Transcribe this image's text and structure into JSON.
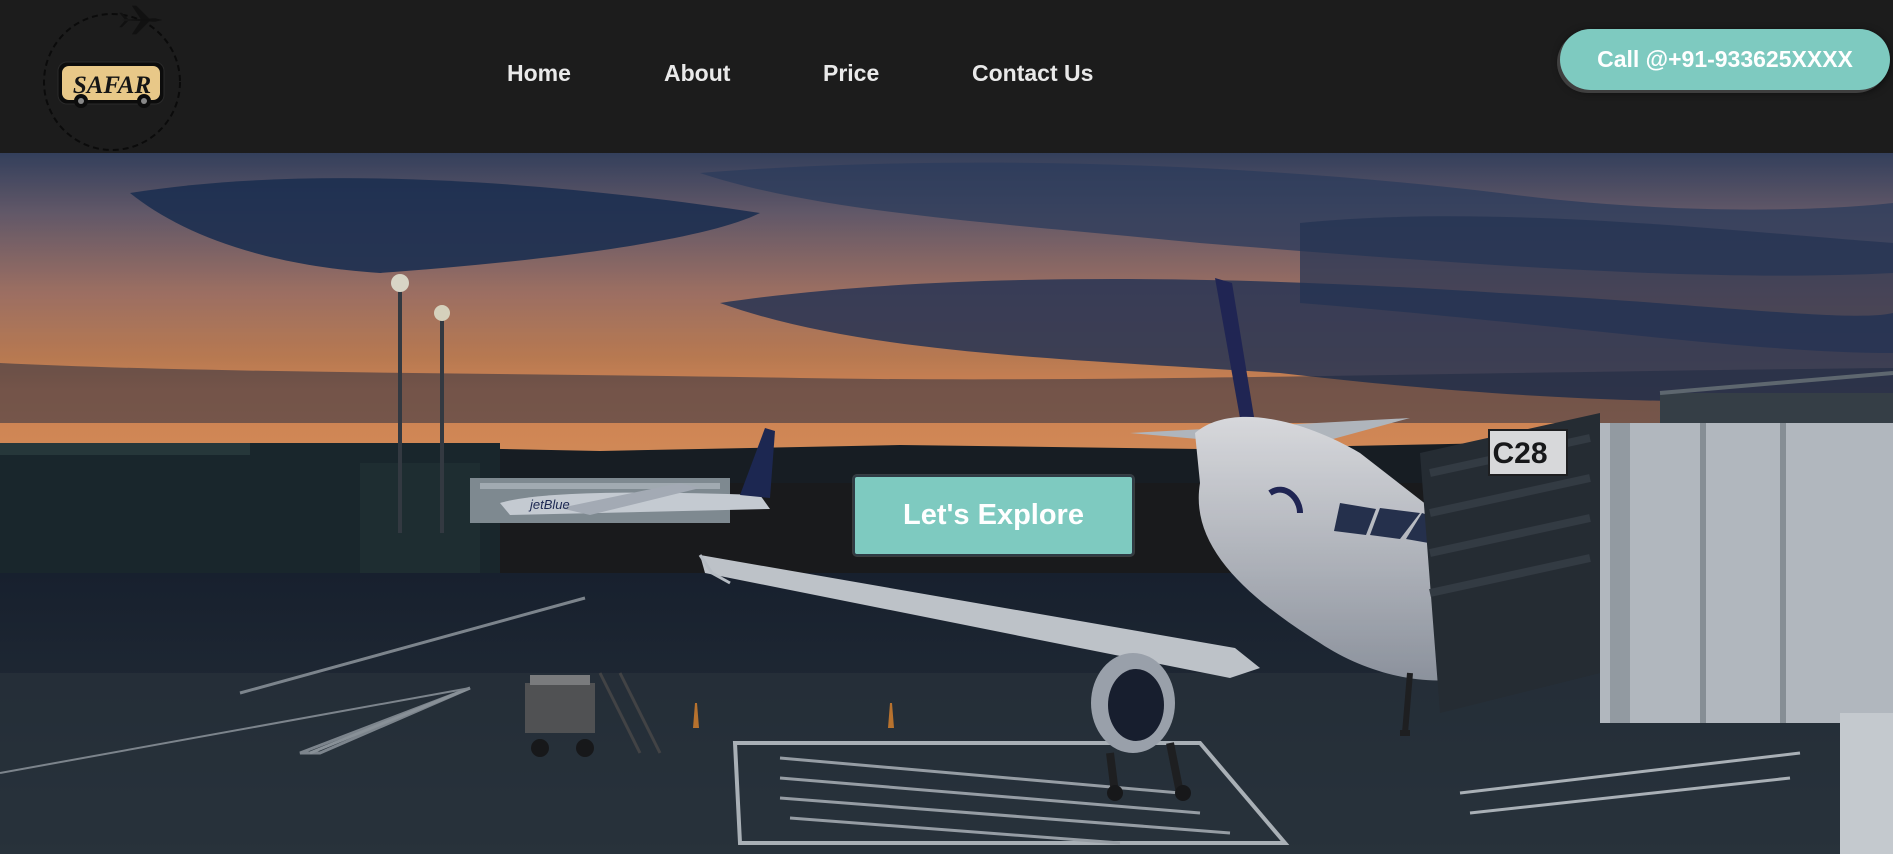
{
  "brand": {
    "logo_text": "SAFAR",
    "logo_icon": "airplane-icon"
  },
  "nav": {
    "links": [
      {
        "label": "Home"
      },
      {
        "label": "About"
      },
      {
        "label": "Price"
      },
      {
        "label": "Contact Us"
      }
    ],
    "call_label": "Call @+91-933625XXXX"
  },
  "hero": {
    "cta_label": "Let's Explore",
    "gate_sign": "C28",
    "plane_livery": "jetBlue"
  },
  "colors": {
    "navbar_bg": "#1c1c1c",
    "accent": "#7ecac0",
    "nav_text": "#e9e9e9"
  }
}
